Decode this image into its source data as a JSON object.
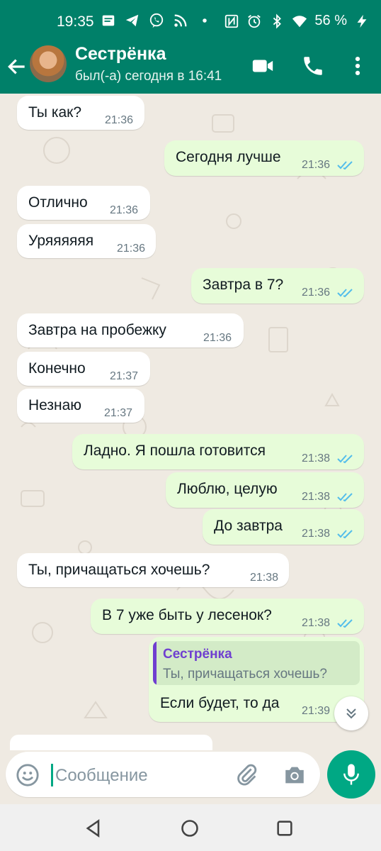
{
  "status_bar": {
    "time": "19:35",
    "battery": "56 %",
    "icons": [
      "notification-icon",
      "telegram-icon",
      "viber-icon",
      "rss-icon",
      "dot-icon",
      "nfc-icon",
      "alarm-icon",
      "bluetooth-icon",
      "wifi-icon",
      "charging-icon"
    ]
  },
  "header": {
    "contact_name": "Сестрёнка",
    "last_seen": "был(-а) сегодня в 16:41"
  },
  "messages": [
    {
      "dir": "in",
      "text": "Ты как?",
      "time": "21:36"
    },
    {
      "dir": "out",
      "text": "Сегодня лучше",
      "time": "21:36"
    },
    {
      "dir": "in",
      "text": "Отлично",
      "time": "21:36"
    },
    {
      "dir": "in",
      "text": "Уряяяяяя",
      "time": "21:36"
    },
    {
      "dir": "out",
      "text": "Завтра в 7?",
      "time": "21:36"
    },
    {
      "dir": "in",
      "text": "Завтра на пробежку",
      "time": "21:36"
    },
    {
      "dir": "in",
      "text": "Конечно",
      "time": "21:37"
    },
    {
      "dir": "in",
      "text": "Незнаю",
      "time": "21:37"
    },
    {
      "dir": "out",
      "text": "Ладно. Я пошла готовится",
      "time": "21:38"
    },
    {
      "dir": "out",
      "text": "Люблю, целую",
      "time": "21:38"
    },
    {
      "dir": "out",
      "text": "До завтра",
      "time": "21:38"
    },
    {
      "dir": "in",
      "text": "Ты, причащаться хочешь?",
      "time": "21:38"
    },
    {
      "dir": "out",
      "text": "В 7 уже быть у лесенок?",
      "time": "21:38"
    },
    {
      "dir": "out",
      "text": "Если будет, то да",
      "time": "21:39",
      "reply_to": {
        "name": "Сестрёнка",
        "text": "Ты, причащаться хочешь?"
      }
    }
  ],
  "composer": {
    "placeholder": "Сообщение"
  },
  "colors": {
    "header": "#008069",
    "outgoing_bubble": "#e7fcd9",
    "incoming_bubble": "#ffffff",
    "accent": "#00a884",
    "read_ticks": "#53bdeb"
  }
}
